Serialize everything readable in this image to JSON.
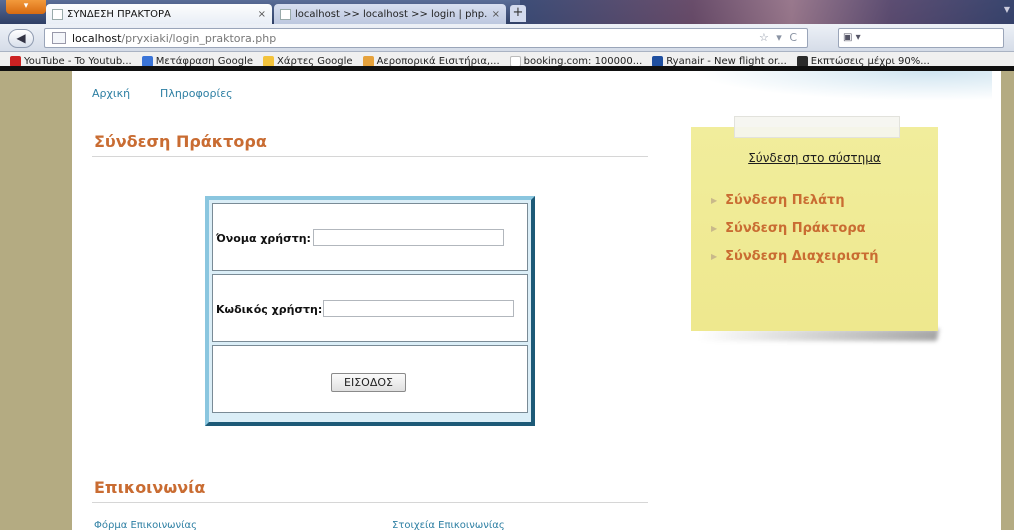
{
  "browser": {
    "menu_button": "▾",
    "tabs": [
      {
        "title": "ΣΥΝΔΕΣΗ ΠΡΑΚΤΟΡΑ",
        "active": true
      },
      {
        "title": "localhost >> localhost >> login | php...",
        "active": false
      }
    ],
    "new_tab": "+",
    "address": {
      "host": "localhost",
      "path": "/pryxiaki/login_praktora.php"
    },
    "bookmarks": [
      {
        "label": "YouTube - To Youtub...",
        "color": "#cc2222"
      },
      {
        "label": "Μετάφραση Google",
        "color": "#3a74d8"
      },
      {
        "label": "Χάρτες Google",
        "color": "#f3c33c"
      },
      {
        "label": "Αεροπορικά Εισιτήρια,...",
        "color": "#e6a23c"
      },
      {
        "label": "booking.com: 100000...",
        "color": "#ffffff"
      },
      {
        "label": "Ryanair - New flight or...",
        "color": "#1f4fa0"
      },
      {
        "label": "Εκπτώσεις μέχρι 90%...",
        "color": "#2b2b2b"
      }
    ]
  },
  "page": {
    "nav": [
      {
        "label": "Αρχική"
      },
      {
        "label": "Πληροφορίες"
      }
    ],
    "heading": "Σύνδεση Πράκτορα",
    "form": {
      "username_label": "Όνομα χρήστη:",
      "username_value": "",
      "password_label": "Κωδικός χρήστη:",
      "password_value": "",
      "submit_label": "ΕΙΣΟΔΟΣ"
    },
    "contact_heading": "Επικοινωνία",
    "contact_links": [
      {
        "label": "Φόρμα Επικοινωνίας"
      },
      {
        "label": "Στοιχεία Επικοινωνίας"
      }
    ],
    "sidebar": {
      "title": "Σύνδεση στο σύστημα",
      "items": [
        {
          "label": "Σύνδεση Πελάτη"
        },
        {
          "label": "Σύνδεση Πράκτορα"
        },
        {
          "label": "Σύνδεση Διαχειριστή"
        }
      ]
    }
  },
  "colors": {
    "accent_orange": "#c96c32",
    "link_blue": "#2d7fa3",
    "note_yellow": "#f1ed9c",
    "frame_blue": "#1d5a77"
  }
}
